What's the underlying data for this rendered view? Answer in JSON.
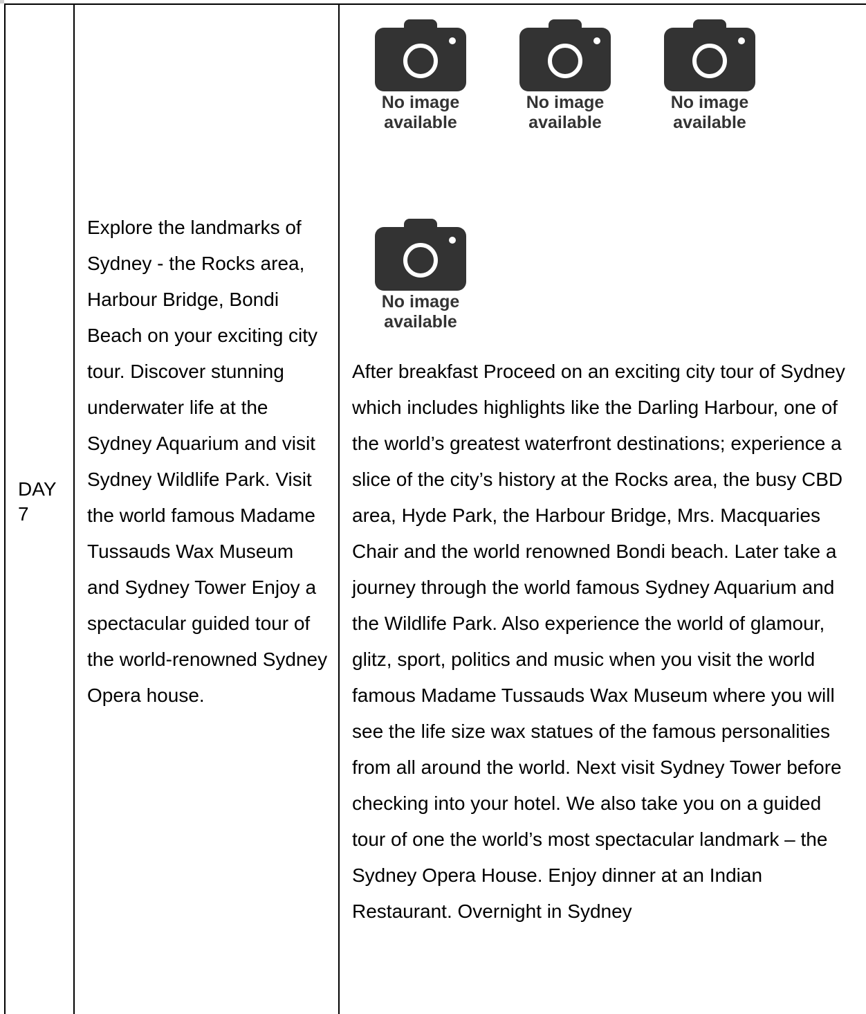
{
  "day": {
    "label": "DAY\n7"
  },
  "summary": {
    "text": "Explore the landmarks of Sydney - the Rocks area, Harbour Bridge, Bondi Beach on your exciting city tour. Discover stunning underwater life at the Sydney Aquarium and visit Sydney Wildlife Park. Visit the world famous Madame Tussauds Wax Museum and Sydney Tower Enjoy a spectacular guided tour of the world-renowned Sydney Opera house."
  },
  "images": [
    {
      "icon": "camera-icon",
      "caption": "No image\navailable"
    },
    {
      "icon": "camera-icon",
      "caption": "No image\navailable"
    },
    {
      "icon": "camera-icon",
      "caption": "No image\navailable"
    },
    {
      "icon": "camera-icon",
      "caption": "No image\navailable"
    }
  ],
  "details": {
    "text": "After breakfast Proceed on an exciting city tour of Sydney which includes highlights like the Darling Harbour, one of the world’s greatest waterfront destinations; experience a slice of the city’s history at the Rocks area, the busy CBD area, Hyde Park, the Harbour Bridge, Mrs. Macquaries Chair and the world renowned Bondi beach. Later take a journey through the world famous Sydney Aquarium and the Wildlife Park. Also experience the world of glamour, glitz, sport, politics and music when you visit the world famous Madame Tussauds Wax Museum where you will see the life size wax statues of the famous personalities from all around the world. Next visit Sydney Tower before checking into your hotel. We also take you on a guided tour of one the world’s most spectacular landmark – the Sydney Opera House. Enjoy dinner at an Indian Restaurant. Overnight in Sydney"
  },
  "colors": {
    "icon": "#333333",
    "border": "#000000"
  }
}
